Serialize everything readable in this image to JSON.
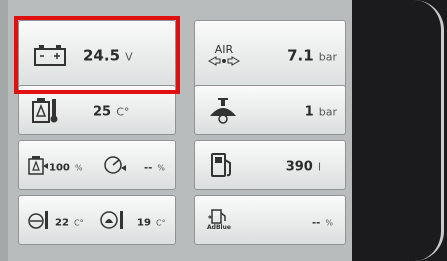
{
  "tiles": {
    "battery": {
      "icon": "battery-icon",
      "value": "24.5",
      "unit": "V"
    },
    "air": {
      "icon_label": "AIR",
      "value": "7.1",
      "unit": "bar"
    },
    "coolant": {
      "icon": "coolant-temperature-icon",
      "value": "25",
      "unit": "C°"
    },
    "oil": {
      "icon": "oil-pressure-icon",
      "value": "1",
      "unit": "bar"
    },
    "load": {
      "value1": "100",
      "unit1": "%",
      "value2": "--",
      "unit2": "%"
    },
    "fuel": {
      "icon": "fuel-pump-icon",
      "value": "390",
      "unit": "l"
    },
    "temps": {
      "value1": "22",
      "unit1": "C°",
      "value2": "19",
      "unit2": "C°"
    },
    "adblue": {
      "icon_label": "AdBlue",
      "value": "--",
      "unit": "%"
    }
  },
  "colors": {
    "highlight": "#e01010",
    "tile": "#f2f3f3",
    "panel": "#b9bcbc"
  }
}
